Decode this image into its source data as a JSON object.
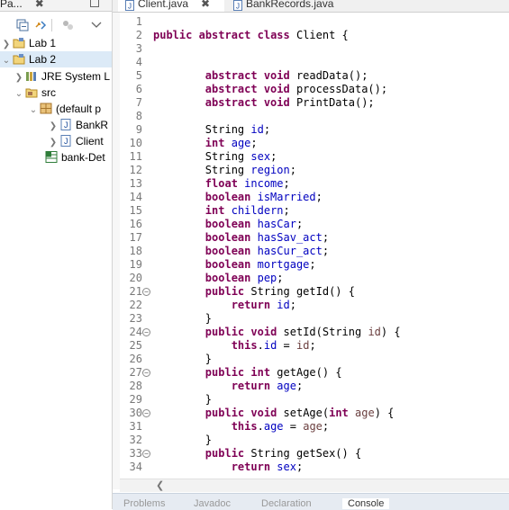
{
  "explorer": {
    "tab_label": "Pa...",
    "close_glyph": "✖",
    "tree": [
      {
        "label": "Lab 1",
        "indent": 0
      },
      {
        "label": "Lab 2",
        "indent": 0
      },
      {
        "label": "JRE System L",
        "indent": 1
      },
      {
        "label": "src",
        "indent": 1
      },
      {
        "label": "(default p",
        "indent": 2
      },
      {
        "label": "BankR",
        "indent": 3
      },
      {
        "label": "Client",
        "indent": 3
      },
      {
        "label": "bank-Det",
        "indent": 2
      }
    ]
  },
  "editor": {
    "tabs": [
      {
        "label": "Client.java",
        "active": true
      },
      {
        "label": "BankRecords.java",
        "active": false
      }
    ],
    "close_glyph": "✖"
  },
  "code_lines": [
    {
      "n": "1",
      "text": ""
    },
    {
      "n": "2",
      "text": "public abstract class Client {"
    },
    {
      "n": "3",
      "text": ""
    },
    {
      "n": "4",
      "text": ""
    },
    {
      "n": "5",
      "text": "        abstract void readData();"
    },
    {
      "n": "6",
      "text": "        abstract void processData();"
    },
    {
      "n": "7",
      "text": "        abstract void PrintData();"
    },
    {
      "n": "8",
      "text": ""
    },
    {
      "n": "9",
      "text": "        String id;"
    },
    {
      "n": "10",
      "text": "        int age;"
    },
    {
      "n": "11",
      "text": "        String sex;"
    },
    {
      "n": "12",
      "text": "        String region;"
    },
    {
      "n": "13",
      "text": "        float income;"
    },
    {
      "n": "14",
      "text": "        boolean isMarried;"
    },
    {
      "n": "15",
      "text": "        int childern;"
    },
    {
      "n": "16",
      "text": "        boolean hasCar;"
    },
    {
      "n": "17",
      "text": "        boolean hasSav_act;"
    },
    {
      "n": "18",
      "text": "        boolean hasCur_act;"
    },
    {
      "n": "19",
      "text": "        boolean mortgage;"
    },
    {
      "n": "20",
      "text": "        boolean pep;"
    },
    {
      "n": "21",
      "text": "        public String getId() {",
      "fold": true
    },
    {
      "n": "22",
      "text": "            return id;"
    },
    {
      "n": "23",
      "text": "        }"
    },
    {
      "n": "24",
      "text": "        public void setId(String id) {",
      "fold": true
    },
    {
      "n": "25",
      "text": "            this.id = id;"
    },
    {
      "n": "26",
      "text": "        }"
    },
    {
      "n": "27",
      "text": "        public int getAge() {",
      "fold": true
    },
    {
      "n": "28",
      "text": "            return age;"
    },
    {
      "n": "29",
      "text": "        }"
    },
    {
      "n": "30",
      "text": "        public void setAge(int age) {",
      "fold": true
    },
    {
      "n": "31",
      "text": "            this.age = age;"
    },
    {
      "n": "32",
      "text": "        }"
    },
    {
      "n": "33",
      "text": "        public String getSex() {",
      "fold": true
    },
    {
      "n": "34",
      "text": "            return sex;"
    }
  ],
  "colors": {
    "keyword": "#7f0055",
    "field": "#0000c0",
    "param": "#6a3e3e",
    "line_number": "#787878"
  },
  "bottom_tabs": [
    "Problems",
    "Javadoc",
    "Declaration",
    "Console"
  ]
}
